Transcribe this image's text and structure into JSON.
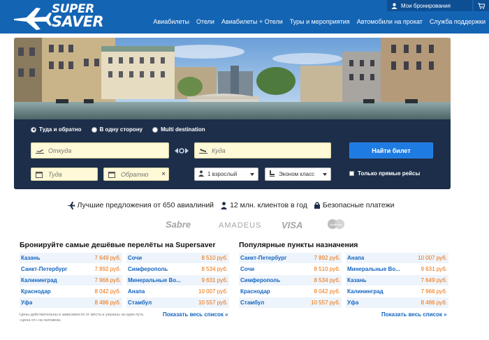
{
  "brand": {
    "line1": "SUPER",
    "line2": "SAVER"
  },
  "topbar": {
    "my_bookings": "Мои бронирования"
  },
  "nav": [
    "Авиабилеты",
    "Отели",
    "Авиабилеты + Отели",
    "Туры и мероприятия",
    "Автомобили на прокат",
    "Служба поддержки"
  ],
  "search": {
    "trip_types": [
      "Туда и обратно",
      "В одну сторону",
      "Multi destination"
    ],
    "selected_trip": "Туда и обратно",
    "from_placeholder": "Откуда",
    "to_placeholder": "Куда",
    "depart_placeholder": "Туда",
    "return_placeholder": "Обратно",
    "passengers": "1 взрослый",
    "cabin_class": "Эконом класс",
    "find_button": "Найти билет",
    "direct_only": "Только прямые рейсы"
  },
  "benefits": [
    "Лучшие предложения от 650 авиалиний",
    "12 млн. клиентов в год",
    "Безопасные платежи"
  ],
  "partners": [
    "Sabre",
    "AMADEUS",
    "VISA",
    "mastercard"
  ],
  "cheap_flights": {
    "title": "Бронируйте самые дешёвые перелёты на Supersaver",
    "col1": [
      {
        "city": "Казань",
        "price": "7 649 руб."
      },
      {
        "city": "Санкт-Петербург",
        "price": "7 892 руб."
      },
      {
        "city": "Калининград",
        "price": "7 966 руб."
      },
      {
        "city": "Краснодар",
        "price": "8 042 руб."
      },
      {
        "city": "Уфа",
        "price": "8 486 руб."
      }
    ],
    "col2": [
      {
        "city": "Сочи",
        "price": "8 510 руб."
      },
      {
        "city": "Симферополь",
        "price": "8 534 руб."
      },
      {
        "city": "Минеральные Во...",
        "price": "9 631 руб."
      },
      {
        "city": "Анапа",
        "price": "10 007 руб."
      },
      {
        "city": "Стамбул",
        "price": "10 557 руб."
      }
    ],
    "note": "Цены действительны в зависимости от места и указаны за один путь «цена от» на человека.",
    "show_all": "Показать весь список »"
  },
  "popular": {
    "title": "Популярные пункты назначения",
    "col1": [
      {
        "city": "Санкт-Петербург",
        "price": "7 892 руб."
      },
      {
        "city": "Сочи",
        "price": "8 510 руб."
      },
      {
        "city": "Симферополь",
        "price": "8 534 руб."
      },
      {
        "city": "Краснодар",
        "price": "8 042 руб."
      },
      {
        "city": "Стамбул",
        "price": "10 557 руб."
      }
    ],
    "col2": [
      {
        "city": "Анапа",
        "price": "10 007 руб."
      },
      {
        "city": "Минеральные Во...",
        "price": "9 631 руб."
      },
      {
        "city": "Казань",
        "price": "7 649 руб."
      },
      {
        "city": "Калининград",
        "price": "7 966 руб."
      },
      {
        "city": "Уфа",
        "price": "8 486 руб."
      }
    ],
    "show_all": "Показать весь список »"
  },
  "colors": {
    "header": "#1464b4",
    "form_bg": "#1c2e4a",
    "button": "#1e7be2",
    "link": "#1565c0",
    "price": "#ef6c00"
  }
}
